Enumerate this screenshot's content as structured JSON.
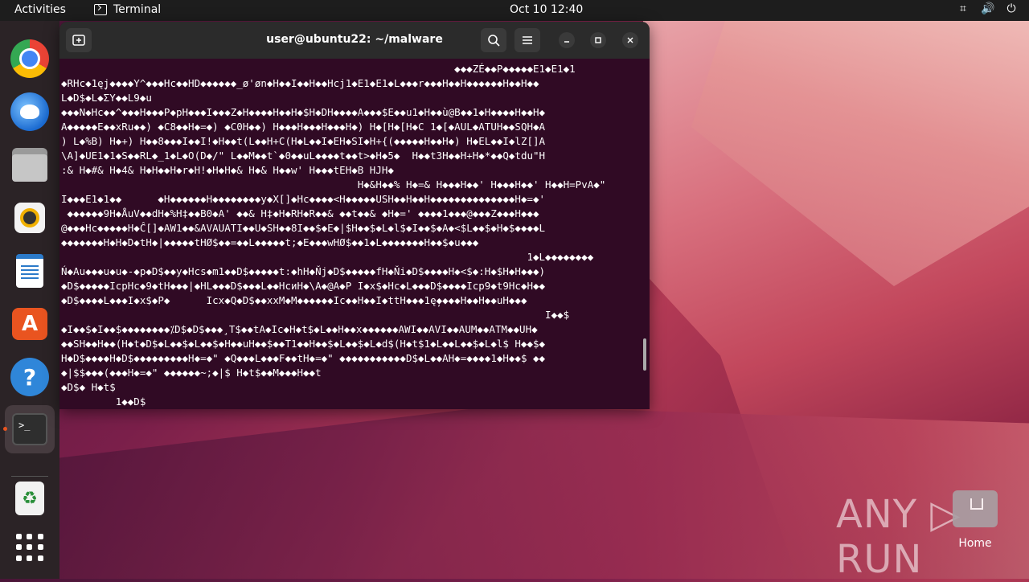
{
  "topbar": {
    "activities": "Activities",
    "app_name": "Terminal",
    "clock": "Oct 10  12:40",
    "tray": {
      "network_icon": "⌗",
      "volume_icon": "🔊",
      "power_icon": "⏻"
    }
  },
  "dock": {
    "apps": [
      "Google Chrome",
      "Thunderbird Mail",
      "Files",
      "Rhythmbox",
      "LibreOffice Writer",
      "Ubuntu Software",
      "Help",
      "Terminal",
      "Trash",
      "Show Applications"
    ],
    "help_glyph": "?",
    "appcenter_glyph": "A",
    "terminal_glyph": ">_",
    "trash_glyph": "♻"
  },
  "window": {
    "title": "user@ubuntu22: ~/malware",
    "terminal_output": "                                                                 ◆◆◆ZÉ◆◆P◆◆◆◆◆E1◆E1◆1\n◆RHc◆1ę̦j◆◆◆◆Y^◆◆◆Hc◆◆HD◆◆◆◆◆◆_ø'øn◆H◆◆I◆◆H◆◆Hcj1◆E1◆E1◆L◆◆◆r◆◆◆H◆◆H◆◆◆◆◆◆H◆◆H◆◆\nL◆D$◆L◆ΣY◆◆L9◆u\n◆◆◆N◆Hc◆◆^◆◆◆H◆◆◆P◆pH◆◆◆I◆◆◆Z◆H◆◆◆◆H◆◆H◆$H◆DH◆◆◆◆A◆◆◆$E◆◆u1◆H◆◆ù@B◆◆1◆H◆◆◆◆H◆◆H◆\nA◆◆◆◆◆E◆◆xRu◆◆) ◆C8◆◆H◆=◆) ◆C0H◆◆) H◆◆◆H◆◆◆H◆◆◆H◆) H◆[H◆[H◆C 1◆[◆AUL◆ATUH◆◆SQH◆A\n) L◆%B) H◆+) H◆◆8◆◆◆I◆◆I!◆H◆◆t(L◆◆H+C(H◆L◆◆I◆EH◆SI◆H+{(◆◆◆◆◆H◆◆H◆) H◆EL◆◆I◆lZ[]A\n\\A]◆UE1◆1◆S◆◆RL◆_1◆L◆O(D◆/\" L◆◆M◆◆t`◆0◆◆uL◆◆◆◆t◆◆t>◆H◆5◆  H◆◆t3H◆◆H+H◆*◆◆Q◆tdu\"H\n:& H◆#& H◆4& H◆H◆◆H◆r◆H!◆H◆H◆& H◆& H◆◆w' H◆◆◆tEH◆B HJH◆\n                                                 H◆&H◆◆% H◆=& H◆◆◆H◆◆' H◆◆◆H◆◆' H◆◆H=PvA◆\"\nI◆◆◆E1◆1◆◆      ◆H◆◆◆◆◆◆H◆◆◆◆◆◆◆◆y◆X[]◆Hc◆◆◆◆<H◆◆◆◆◆USH◆◆H◆◆H◆◆◆◆◆◆◆◆◆◆◆◆◆◆H◆=◆'\n ◆◆◆◆◆◆9H◆ÅuV◆◆dH◆%H‡◆◆B0◆A' ◆◆& H‡◆H◆RH◆R◆◆& ◆◆t◆◆& ◆H◆=' ◆◆◆◆1◆◆◆@◆◆◆Z◆◆◆H◆◆◆\n@◆◆◆Hc◆◆◆◆◆H◆Ĉ[]◆AW1◆◆&AVAUATI◆◆U◆SH◆◆8I◆◆$◆E◆|$H◆◆$◆L◆l$◆I◆◆$◆A◆<$L◆◆$◆H◆$◆◆◆◆L\n◆◆◆◆◆◆◆H◆H◆D◆tH◆|◆◆◆◆◆tHØ$◆◆=◆◆L◆◆◆◆◆t;◆E◆◆◆wHØ$◆◆1◆L◆◆◆◆◆◆◆H◆◆$◆u◆◆◆\n                                                                             1◆L◆◆◆◆◆◆◆◆\nŃ◆Au◆◆◆u◆u◆-◆p◆D$◆◆y◆Hcs◆m1◆◆D$◆◆◆◆◆t:◆hH◆Ňj◆D$◆◆◆◆◆fH◆Ňi◆D$◆◆◆◆H◆<$◆:H◆$H◆H◆◆◆)\n◆D$◆◆◆◆◆IcpHc◆9◆tH◆◆◆|◆HL◆◆◆D$◆◆◆L◆◆HcиH◆\\A◆@A◆P I◆x$◆Hc◆L◆◆◆D$◆◆◆◆Icp9◆t9Hc◆H◆◆\n◆D$◆◆◆◆L◆◆◆I◆x$◆P◆      Icx◆Q◆D$◆◆xxM◆M◆◆◆◆◆◆Ic◆◆H◆◆I◆ttH◆◆◆1ę̦◆◆◆◆H◆◆H◆◆uH◆◆◆\n                                                                                I◆◆$\n◆I◆◆$◆I◆◆$◆◆◆◆◆◆◆◆⁒D$◆D$◆◆◆¸T$◆◆tA◆Ic◆H◆t$◆L◆◆H◆◆x◆◆◆◆◆◆AWI◆◆AVI◆◆AUM◆◆ATM◆◆UH◆\n◆◆SH◆◆H◆◆(H◆t◆D$◆L◆◆$◆L◆◆$◆H◆◆uH◆◆$◆◆T1◆◆H◆◆$◆L◆◆$◆L◆d$(H◆t$1◆L◆◆L◆◆$◆L◆l$ H◆◆$◆\nH◆D$◆◆◆◆H◆D$◆◆◆◆◆◆◆◆◆H◆=◆\" ◆Q◆◆◆L◆◆◆F◆◆tH◆=◆\" ◆◆◆◆◆◆◆◆◆◆◆D$◆L◆◆AH◆=◆◆◆◆1◆H◆◆$ ◆◆\n◆|$$◆◆◆(◆◆◆H◆=◆\" ◆◆◆◆◆◆~;◆|$ H◆t$◆◆M◆◆◆H◆◆t\n◆D$◆ H◆t$\n         1◆◆D$"
  },
  "desktop": {
    "home_label": "Home",
    "watermark": "ANY ▷ RUN"
  }
}
